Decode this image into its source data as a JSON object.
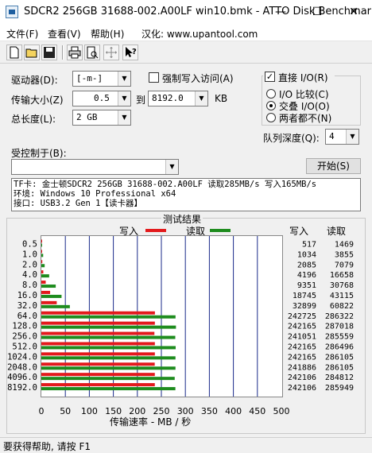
{
  "window": {
    "title": "SDCR2 256GB 31688-002.A00LF win10.bmk - ATTO Disk Benchmark",
    "minimize": "—",
    "maximize": "☐",
    "close": "✕"
  },
  "menu": [
    "文件(F)",
    "查看(V)",
    "帮助(H)",
    "汉化: www.upantool.com"
  ],
  "toolbar": {
    "icons": [
      "new-icon",
      "open-icon",
      "save-icon",
      "print-icon",
      "print-preview-icon",
      "move-icon",
      "help-pointer-icon"
    ]
  },
  "form": {
    "drive_label": "驱动器(D):",
    "drive_value": "[-m-]",
    "force_write_label": "强制写入访问(A)",
    "force_write_checked": false,
    "direct_io_label": "直接 I/O(R)",
    "direct_io_checked": true,
    "transfer_label": "传输大小(Z)",
    "transfer_from": "0.5",
    "to_label": "到",
    "transfer_to": "8192.0",
    "kb_label": "KB",
    "total_label": "总长度(L):",
    "total_value": "2 GB",
    "io_compare_label": "I/O 比较(C)",
    "overlap_io_label": "交叠 I/O(O)",
    "neither_label": "两者都不(N)",
    "queue_label": "队列深度(Q):",
    "queue_value": "4",
    "controlled_label": "受控制于(B):",
    "controlled_value": "",
    "start_button": "开始(S)"
  },
  "info": [
    "TF卡: 金士顿SDCR2 256GB 31688-002.A00LF 读取285MB/s 写入165MB/s",
    "环境: Windows 10 Professional x64",
    "接口: USB3.2 Gen 1【读卡器】"
  ],
  "results": {
    "title": "测试结果",
    "legend_write": "写入",
    "legend_read": "读取",
    "col_write": "写入",
    "col_read": "读取",
    "xlabel": "传输速率 - MB / 秒"
  },
  "status": "要获得帮助, 请按 F1",
  "colors": {
    "write": "#e31a1c",
    "read": "#1e8c1e"
  },
  "chart_data": {
    "type": "bar",
    "orientation": "horizontal",
    "categories": [
      "0.5",
      "1.0",
      "2.0",
      "4.0",
      "8.0",
      "16.0",
      "32.0",
      "64.0",
      "128.0",
      "256.0",
      "512.0",
      "1024.0",
      "2048.0",
      "4096.0",
      "8192.0"
    ],
    "series": [
      {
        "name": "写入",
        "values_mb": [
          0.5,
          1.0,
          2.0,
          4.1,
          9.1,
          18.3,
          32.1,
          236.6,
          236.5,
          235.5,
          236.5,
          236.5,
          236.2,
          236.4,
          236.4
        ],
        "values": [
          "517",
          "1034",
          "2085",
          "4196",
          "9351",
          "18745",
          "32899",
          "242725",
          "242165",
          "241051",
          "242165",
          "242165",
          "241886",
          "242106",
          "242106"
        ]
      },
      {
        "name": "读取",
        "values_mb": [
          1.4,
          3.8,
          6.9,
          16.3,
          30.0,
          42.1,
          59.4,
          279.5,
          280.4,
          279.0,
          279.8,
          279.4,
          279.4,
          277.8,
          279.2
        ],
        "values": [
          "1469",
          "3855",
          "7079",
          "16658",
          "30768",
          "43115",
          "60822",
          "286322",
          "287018",
          "285559",
          "286496",
          "286105",
          "286105",
          "284812",
          "285949"
        ]
      }
    ],
    "xticks": [
      "0",
      "50",
      "100",
      "150",
      "200",
      "250",
      "300",
      "350",
      "400",
      "450",
      "500"
    ],
    "xlim": [
      0,
      500
    ],
    "xlabel": "传输速率 - MB / 秒",
    "legend": "top"
  }
}
